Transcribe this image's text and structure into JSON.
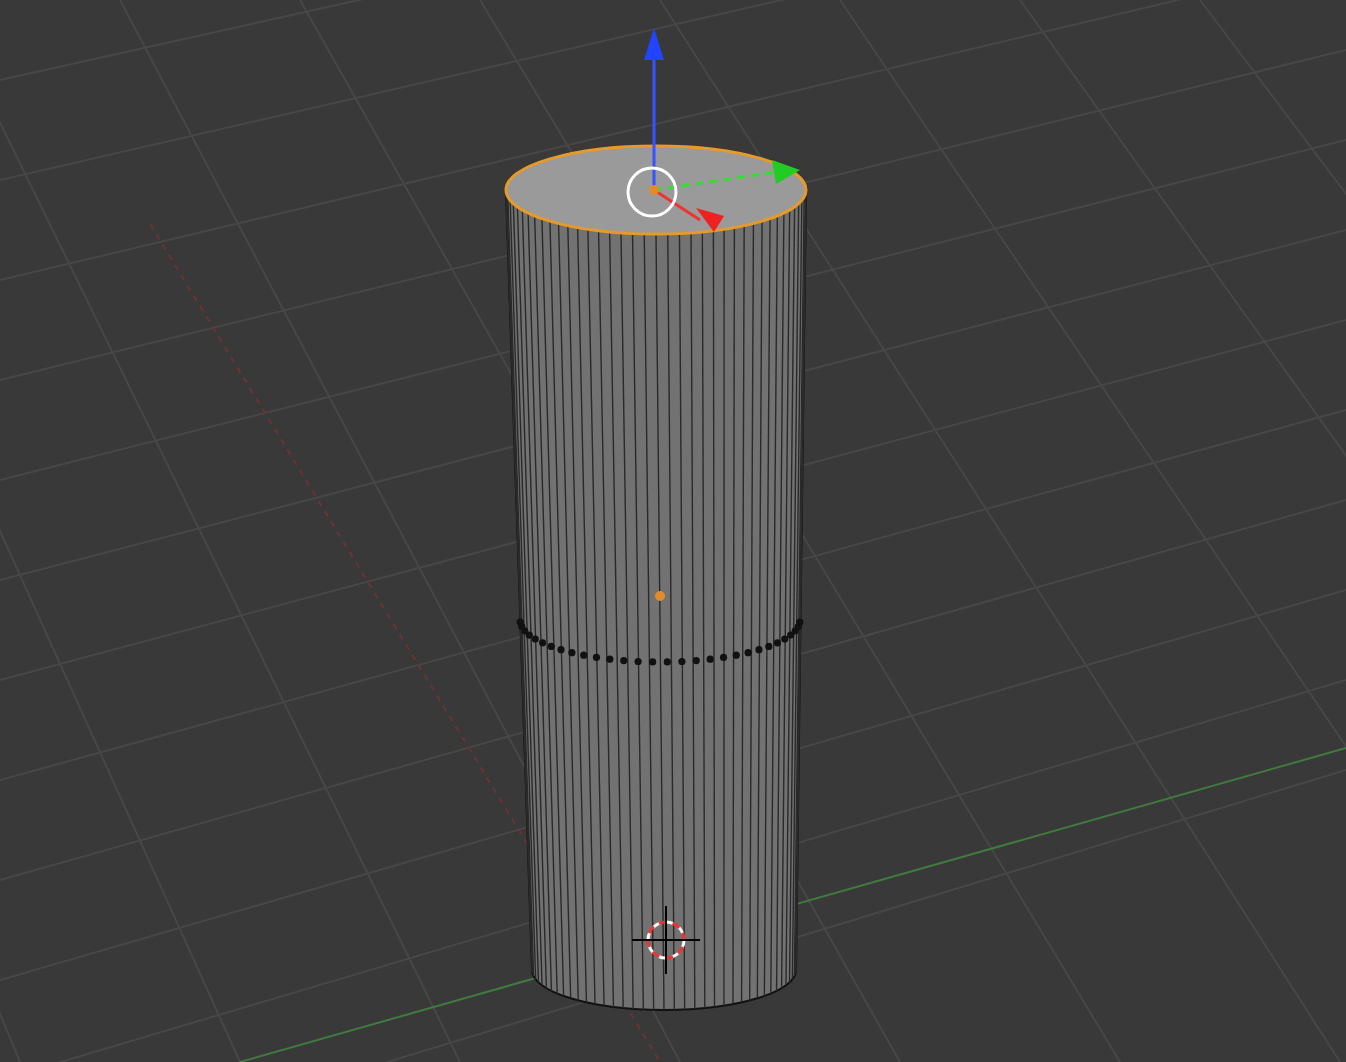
{
  "viewport": {
    "show_grid": true,
    "top_face_selected": true
  }
}
